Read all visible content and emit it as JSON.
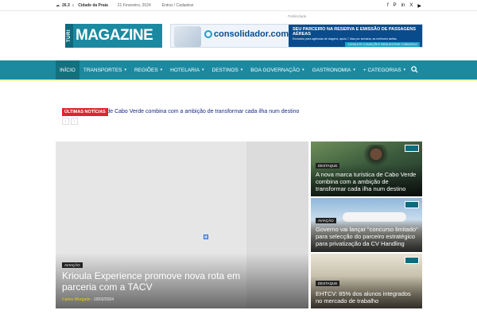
{
  "topbar": {
    "temperature": "26.3",
    "temp_unit": "C",
    "city": "Cidade da Praia",
    "date": "21 Fevereiro, 2024",
    "login": "Entrar / Cadastrar",
    "social": [
      "f",
      "P",
      "in",
      "X",
      "▶"
    ]
  },
  "header": {
    "ad_label": "Publicidade",
    "logo_side": "TURI",
    "logo_main": "MAGAZINE",
    "banner": {
      "brand": "consolidador.com",
      "headline": "SEU PARCEIRO NA RESERVA E EMISSÃO DE PASSAGENS AÉREAS",
      "subline": "Exclusivo para agências de viagens, apoio 7 dias por semana, as melhores tarifas",
      "cta": "CONSULTE CONDIÇÕES PARA ENTRAR CONNOSCO"
    }
  },
  "nav": {
    "items": [
      {
        "label": "Início",
        "dropdown": false
      },
      {
        "label": "Transportes",
        "dropdown": true
      },
      {
        "label": "Regiões",
        "dropdown": true
      },
      {
        "label": "Hotelaria",
        "dropdown": true
      },
      {
        "label": "Destinos",
        "dropdown": true
      },
      {
        "label": "Boa Governação",
        "dropdown": true
      },
      {
        "label": "Gastronomia",
        "dropdown": true
      },
      {
        "label": "+ Categorias",
        "dropdown": true
      }
    ]
  },
  "ticker": {
    "label": "Últimas Notícias",
    "text": "stica de Cabo Verde combina com a ambição de transformar cada ilha num destino"
  },
  "featured": {
    "category": "AVIAÇÃO",
    "title": "Krioula Experience promove nova rota em parceria com a TACV",
    "author": "Carlos Morgado",
    "date": "19/02/2024"
  },
  "side_cards": [
    {
      "category": "DESTAQUE",
      "title": "A nova marca turística de Cabo Verde combina com a ambição de transformar cada ilha num destino"
    },
    {
      "category": "AVIAÇÃO",
      "title": "Governo vai lançar \"concurso limitado\" para selecção do parceiro estratégico para privatização da CV Handling"
    },
    {
      "category": "DESTAQUE",
      "title": "EHTCV: 85% dos alunos integrados no mercado de trabalho"
    }
  ],
  "colors": {
    "nav": "#1b8aa0",
    "ticker": "#e2232a",
    "accent": "#f2d10a"
  }
}
